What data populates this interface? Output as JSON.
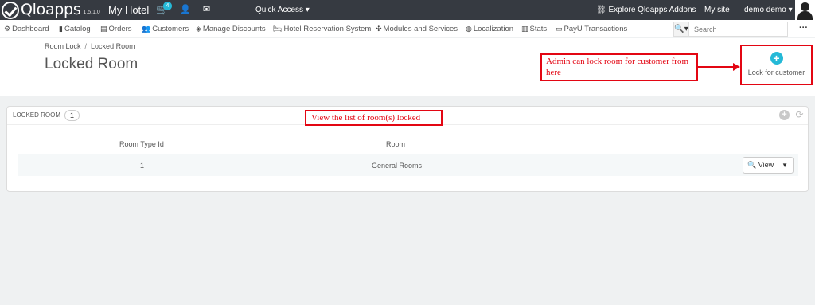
{
  "topbar": {
    "logo_text": "Qloapps",
    "version": "1.5.1.0",
    "shop_name": "My Hotel",
    "cart_count": "4",
    "quick_access": "Quick Access ▾",
    "explore": "Explore Qloapps Addons",
    "my_site": "My site",
    "user_name": "demo demo ▾"
  },
  "nav": {
    "items": [
      {
        "icon": "⚙",
        "label": "Dashboard"
      },
      {
        "icon": "▮",
        "label": "Catalog"
      },
      {
        "icon": "▤",
        "label": "Orders"
      },
      {
        "icon": "👥",
        "label": "Customers"
      },
      {
        "icon": "◈",
        "label": "Manage Discounts"
      },
      {
        "icon": "🛏",
        "label": "Hotel Reservation System"
      },
      {
        "icon": "✣",
        "label": "Modules and Services"
      },
      {
        "icon": "◍",
        "label": "Localization"
      },
      {
        "icon": "▥",
        "label": "Stats"
      },
      {
        "icon": "▭",
        "label": "PayU Transactions"
      }
    ],
    "search_placeholder": "Search"
  },
  "header": {
    "breadcrumb": [
      "Room Lock",
      "Locked Room"
    ],
    "title": "Locked Room",
    "annotation": "Admin can lock room for customer from here",
    "lock_button_label": "Lock for customer"
  },
  "panel": {
    "title": "Locked Room",
    "count": "1",
    "annotation": "View the list of room(s) locked",
    "columns": [
      "Room Type Id",
      "Room"
    ],
    "rows": [
      {
        "room_type_id": "1",
        "room": "General Rooms",
        "action": "View"
      }
    ]
  },
  "colors": {
    "topbar": "#363a41",
    "accent": "#25b9d7",
    "annotation_red": "#e30613"
  }
}
